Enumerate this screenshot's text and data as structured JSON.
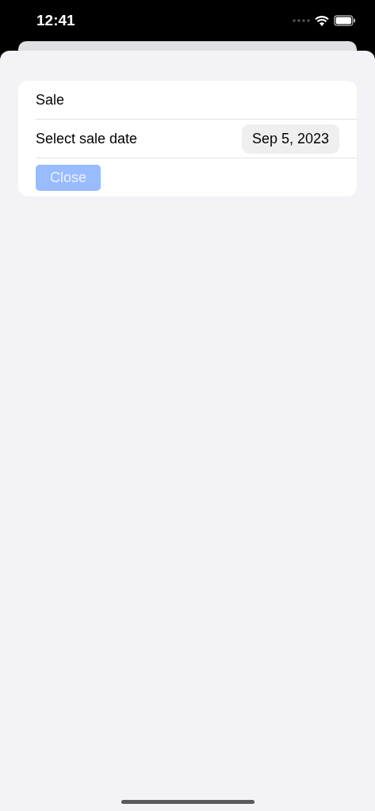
{
  "status_bar": {
    "time": "12:41"
  },
  "form": {
    "title": "Sale",
    "date_row": {
      "label": "Select sale date",
      "value": "Sep 5, 2023"
    },
    "close_button": {
      "label": "Close",
      "disabled": true
    }
  }
}
